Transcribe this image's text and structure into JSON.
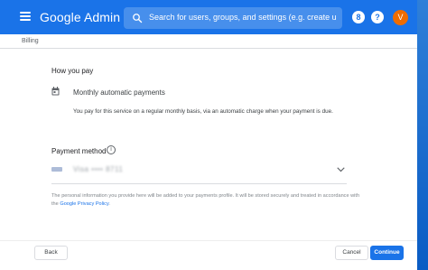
{
  "app": {
    "title": "Google Admin",
    "brand_color": "#1a73e8"
  },
  "search": {
    "placeholder": "Search for users, groups, and settings (e.g. create u"
  },
  "header_actions": {
    "support_label": "8",
    "help_label": "?",
    "avatar_letter": "V",
    "avatar_color": "#ef6c00"
  },
  "breadcrumb": "Billing",
  "how_you_pay": {
    "heading": "How you pay",
    "type": "Monthly automatic payments",
    "description": "You pay for this service on a regular monthly basis, via an automatic charge when your payment is due."
  },
  "payment_method": {
    "heading": "Payment method",
    "card_label": "Visa •••• 8711",
    "privacy_text": "The personal information you provide here will be added to your payments profile. It will be stored securely and treated in accordance with the ",
    "privacy_link": "Google Privacy Policy",
    "privacy_suffix": "."
  },
  "footer": {
    "back": "Back",
    "cancel": "Cancel",
    "continue": "Continue"
  }
}
